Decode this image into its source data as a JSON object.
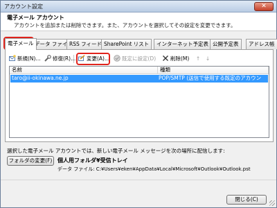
{
  "window": {
    "title": "アカウント設定",
    "close_label": "✕"
  },
  "header": {
    "title": "電子メール アカウント",
    "subtitle": "アカウントを追加または削除できます。また、アカウントを選択してその設定を変更できます。"
  },
  "tabs": [
    {
      "label": "電子メール"
    },
    {
      "label": "データ ファイル"
    },
    {
      "label": "RSS フィード"
    },
    {
      "label": "SharePoint リスト"
    },
    {
      "label": "インターネット予定表"
    },
    {
      "label": "公開予定表"
    },
    {
      "label": "アドレス帳"
    }
  ],
  "toolbar": {
    "new_label": "新規(N)...",
    "repair_label": "修復(R)...",
    "change_label": "変更(A)...",
    "default_label": "既定に設定(D)",
    "delete_label": "削除(M)",
    "up_label": "↑",
    "down_label": "↓"
  },
  "list": {
    "columns": [
      "名前",
      "種類"
    ],
    "rows": [
      {
        "name": "taro@ii-okinawa.ne.jp",
        "type": "POP/SMTP (送信で使用する既定のアカウント)"
      }
    ]
  },
  "footer": {
    "info": "選択した電子メール アカウントでは、新しい電子メール メッセージを次の場所に配信します:",
    "change_folder_label": "フォルダの変更(F)",
    "folder_name": "個人用フォルダ¥受信トレイ",
    "data_file": "データ ファイル: C:¥Users¥eken¥AppData¥Local¥Microsoft¥Outlook¥Outlook.pst",
    "close_label": "閉じる(C)"
  },
  "colors": {
    "highlight_ring": "#e0231c",
    "selection": "#3399ff"
  }
}
